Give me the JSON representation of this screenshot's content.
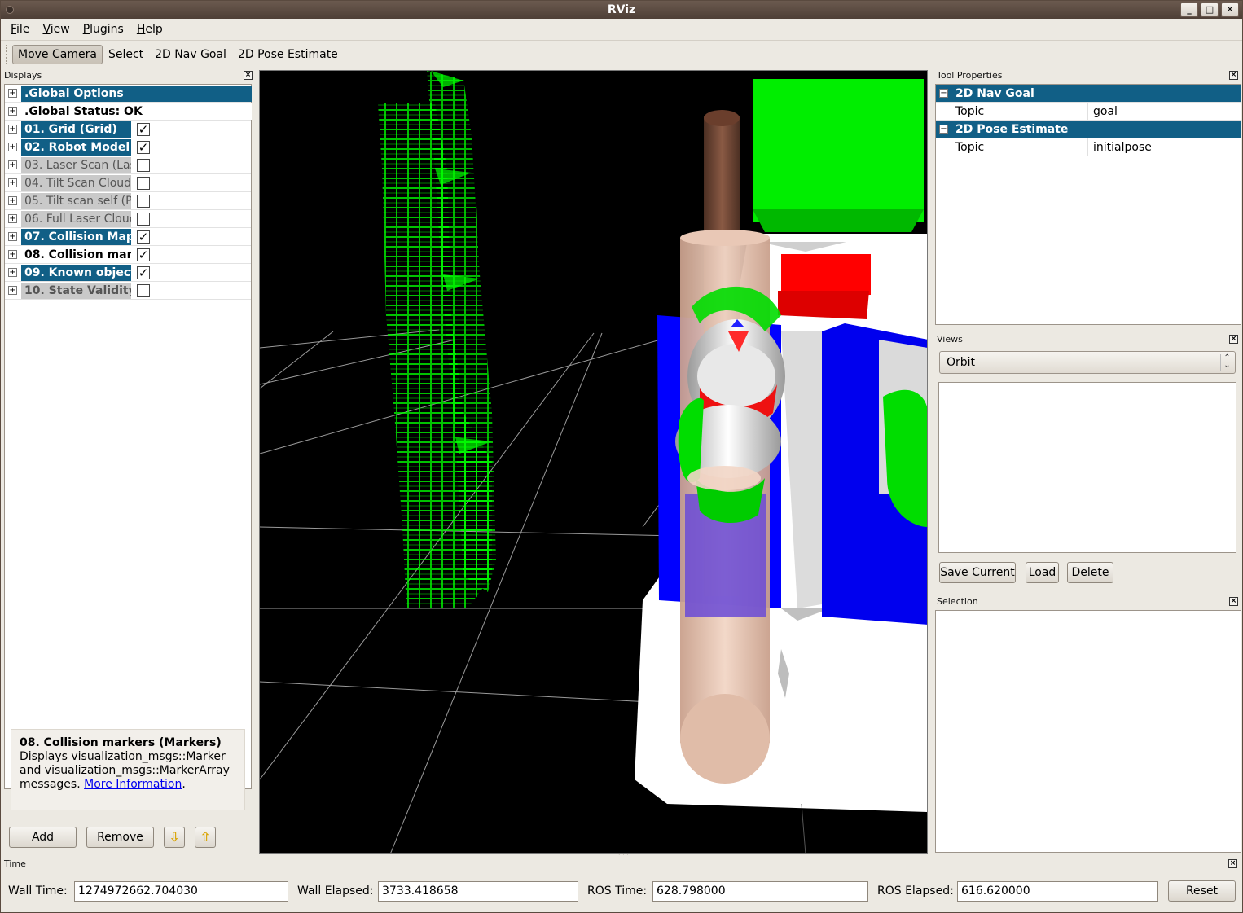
{
  "window": {
    "title": "RViz"
  },
  "menu": [
    "File",
    "View",
    "Plugins",
    "Help"
  ],
  "toolbar": {
    "tools": [
      "Move Camera",
      "Select",
      "2D Nav Goal",
      "2D Pose Estimate"
    ],
    "active": "Move Camera"
  },
  "displays": {
    "header": "Displays",
    "items": [
      {
        "label": ".Global Options",
        "state": "selected",
        "checkbox": null
      },
      {
        "label": ".Global Status: OK",
        "state": "plain",
        "checkbox": null
      },
      {
        "label": "01. Grid (Grid)",
        "state": "selected",
        "checkbox": true
      },
      {
        "label": "02. Robot Model",
        "state": "selected",
        "checkbox": true
      },
      {
        "label": "03. Laser Scan (Laser",
        "state": "disabled",
        "checkbox": false
      },
      {
        "label": "04. Tilt Scan Cloud",
        "state": "disabled",
        "checkbox": false
      },
      {
        "label": "05. Tilt scan self (Po",
        "state": "disabled",
        "checkbox": false
      },
      {
        "label": "06. Full Laser Cloud",
        "state": "disabled",
        "checkbox": false
      },
      {
        "label": "07. Collision Map",
        "state": "selected",
        "checkbox": true
      },
      {
        "label": "08. Collision mar",
        "state": "plain",
        "checkbox": true
      },
      {
        "label": "09. Known object",
        "state": "selected",
        "checkbox": true
      },
      {
        "label": "10. State Validity",
        "state": "disabled-bold",
        "checkbox": false
      }
    ],
    "description": {
      "title": "08. Collision markers (Markers)",
      "text": "Displays visualization_msgs::Marker and visualization_msgs::MarkerArray messages.",
      "link": "More Information",
      "after_link": "."
    },
    "buttons": {
      "add": "Add",
      "remove": "Remove"
    }
  },
  "tool_properties": {
    "header": "Tool Properties",
    "groups": [
      {
        "name": "2D Nav Goal",
        "prop": "Topic",
        "value": "goal"
      },
      {
        "name": "2D Pose Estimate",
        "prop": "Topic",
        "value": "initialpose"
      }
    ]
  },
  "views": {
    "header": "Views",
    "selected": "Orbit",
    "buttons": {
      "save": "Save Current",
      "load": "Load",
      "delete": "Delete"
    }
  },
  "selection": {
    "header": "Selection"
  },
  "time": {
    "header": "Time",
    "wall_time_label": "Wall Time:",
    "wall_time": "1274972662.704030",
    "wall_elapsed_label": "Wall Elapsed:",
    "wall_elapsed": "3733.418658",
    "ros_time_label": "ROS Time:",
    "ros_time": "628.798000",
    "ros_elapsed_label": "ROS Elapsed:",
    "ros_elapsed": "616.620000",
    "reset": "Reset"
  },
  "icons": {
    "close": "close-icon",
    "minimize": "minimize-icon",
    "maximize": "maximize-icon",
    "expand": "expand-icon",
    "collapse": "collapse-icon",
    "move_up": "arrow-up-icon",
    "move_down": "arrow-down-icon"
  },
  "colors": {
    "selection_blue": "#115f86",
    "collision_green": "#00ff00",
    "viewport_bg": "#000000"
  }
}
